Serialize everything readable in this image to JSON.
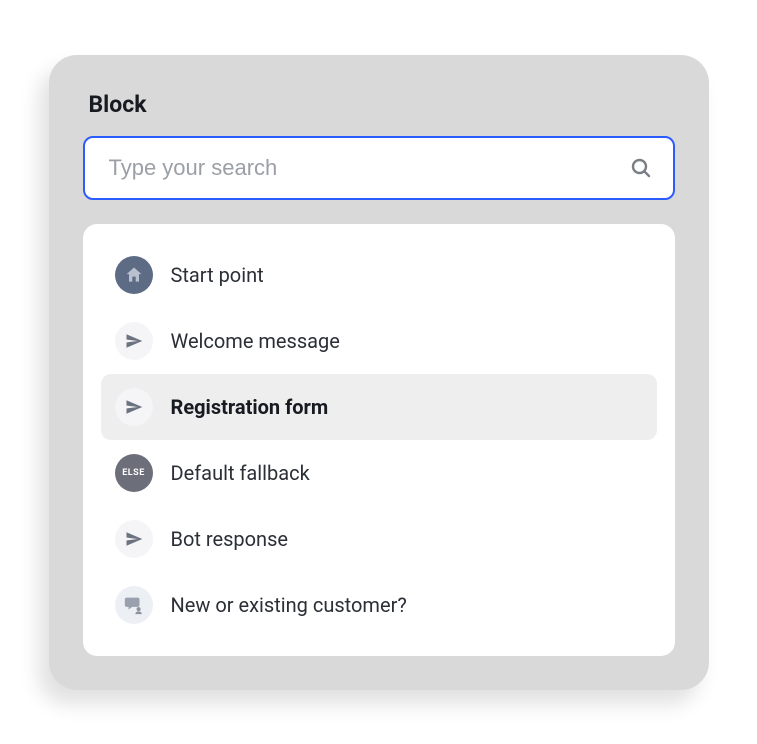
{
  "panel": {
    "title": "Block"
  },
  "search": {
    "placeholder": "Type your search"
  },
  "items": [
    {
      "label": "Start point",
      "icon": "home-icon",
      "selected": false
    },
    {
      "label": "Welcome message",
      "icon": "send-icon",
      "selected": false
    },
    {
      "label": "Registration form",
      "icon": "send-icon",
      "selected": true
    },
    {
      "label": "Default fallback",
      "icon": "else-icon",
      "icon_text": "ELSE",
      "selected": false
    },
    {
      "label": "Bot response",
      "icon": "send-icon",
      "selected": false
    },
    {
      "label": "New or existing customer?",
      "icon": "chat-icon",
      "selected": false
    }
  ],
  "colors": {
    "accent": "#2c5cff",
    "panel_bg": "#d9d9d9"
  }
}
